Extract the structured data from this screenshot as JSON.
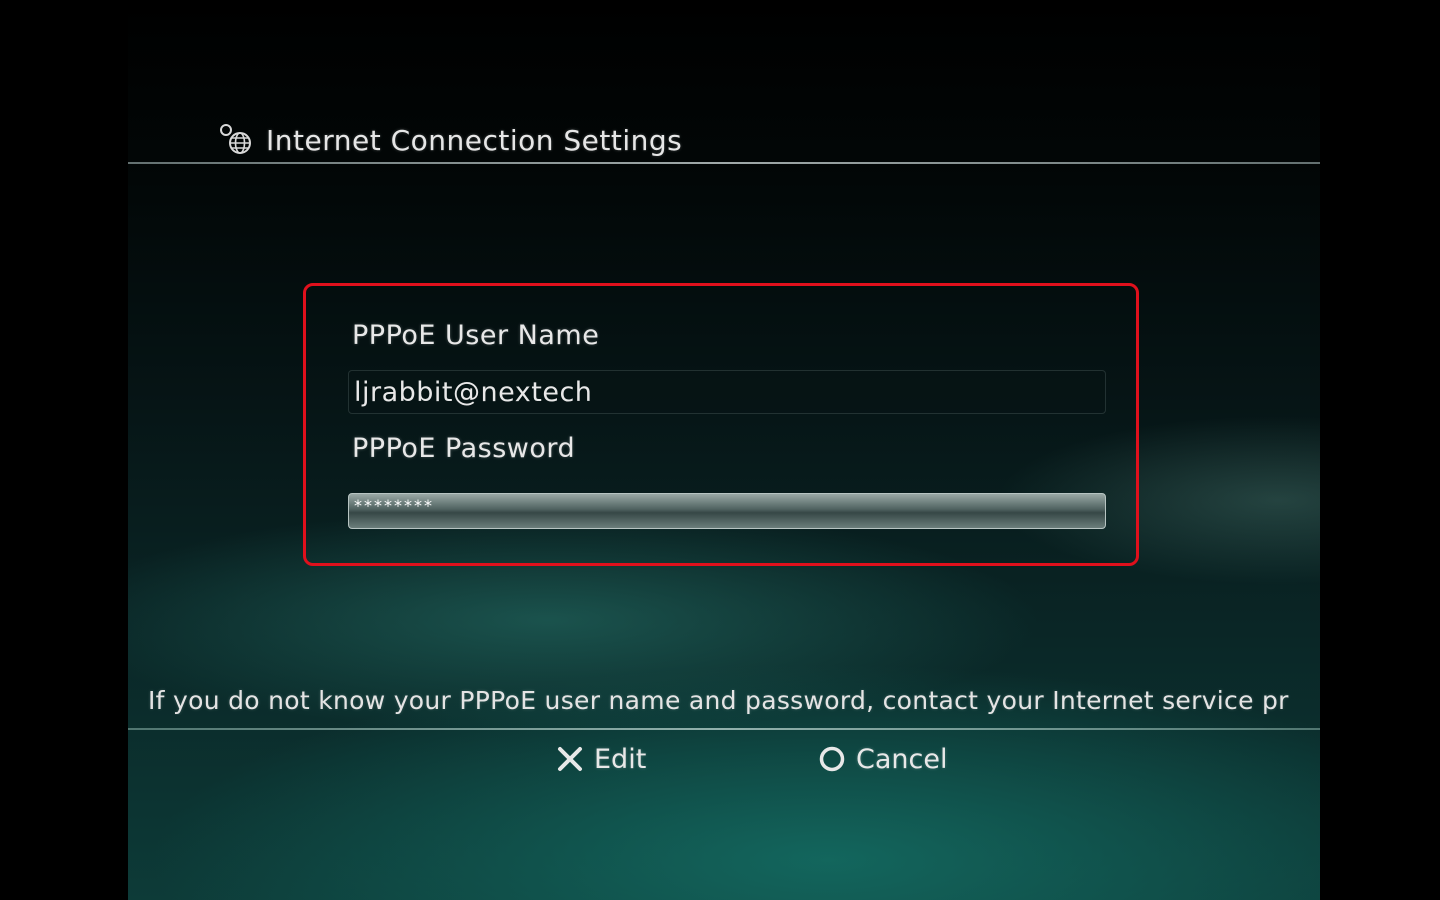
{
  "header": {
    "title": "Internet Connection Settings",
    "icon": "network-settings-icon"
  },
  "form": {
    "username_label": "PPPoE User Name",
    "username_value": "ljrabbit@nextech",
    "password_label": "PPPoE Password",
    "password_value": "********"
  },
  "help_text": "If you do not know your PPPoE user name and password, contact your Internet service pr",
  "actions": {
    "edit_label": "Edit",
    "edit_icon": "cross-button-icon",
    "cancel_label": "Cancel",
    "cancel_icon": "circle-button-icon"
  },
  "colors": {
    "highlight_border": "#e0101c",
    "text": "#e8e8e8",
    "background_teal": "#0d3b38"
  }
}
